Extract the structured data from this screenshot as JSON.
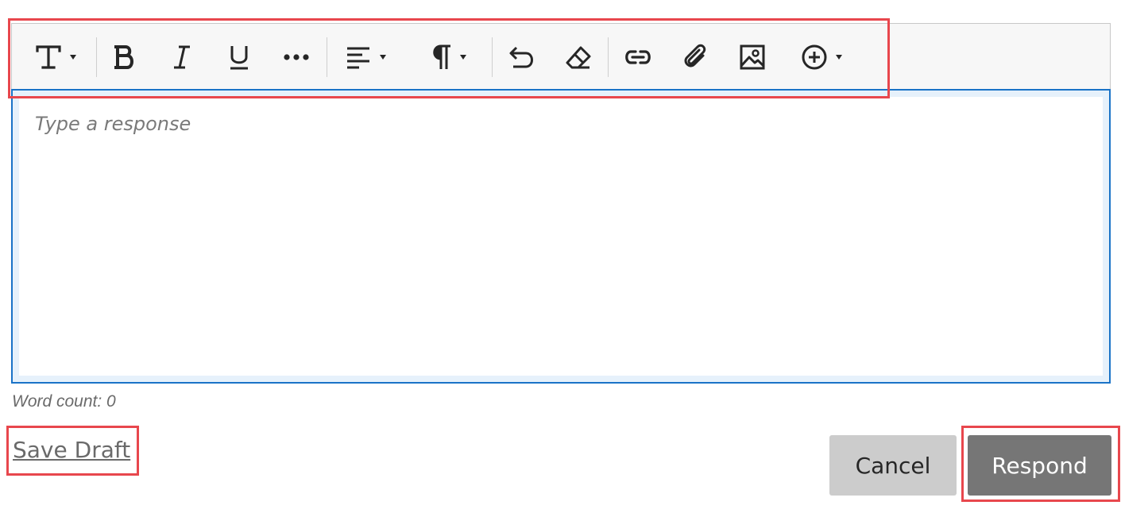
{
  "editor": {
    "placeholder": "Type a response",
    "value": "",
    "toolbar": {
      "buttons": [
        {
          "name": "text-format",
          "icon": "text-format-icon",
          "dropdown": true
        },
        {
          "name": "bold",
          "icon": "bold-icon"
        },
        {
          "name": "italic",
          "icon": "italic-icon"
        },
        {
          "name": "underline",
          "icon": "underline-icon"
        },
        {
          "name": "more",
          "icon": "more-horizontal-icon"
        },
        {
          "name": "align",
          "icon": "align-left-icon",
          "dropdown": true
        },
        {
          "name": "paragraph",
          "icon": "paragraph-icon",
          "dropdown": true
        },
        {
          "name": "undo",
          "icon": "undo-icon"
        },
        {
          "name": "clear-format",
          "icon": "eraser-icon"
        },
        {
          "name": "link",
          "icon": "link-icon"
        },
        {
          "name": "attach",
          "icon": "paperclip-icon"
        },
        {
          "name": "image",
          "icon": "image-icon"
        },
        {
          "name": "insert",
          "icon": "plus-circle-icon",
          "dropdown": true
        }
      ]
    }
  },
  "word_count": "Word count: 0",
  "actions": {
    "save_draft": "Save Draft",
    "cancel": "Cancel",
    "respond": "Respond"
  },
  "colors": {
    "highlight": "#e8474d",
    "focus_border": "#1a73c7",
    "respond_bg": "#767676",
    "cancel_bg": "#cccccc"
  }
}
